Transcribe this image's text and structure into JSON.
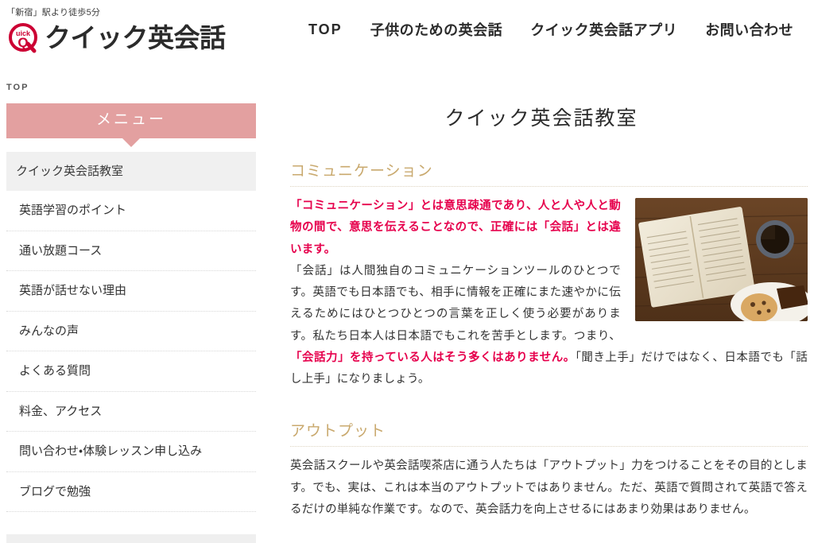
{
  "header": {
    "tagline": "「新宿」駅より徒歩5分",
    "brand_name": "クイック英会話",
    "logo_mark_text": "uick",
    "logo_letter": "Q",
    "brand_color": "#cc0033",
    "nav": [
      {
        "label": "TOP",
        "latin": true
      },
      {
        "label": "子供のための英会話",
        "latin": false
      },
      {
        "label": "クイック英会話アプリ",
        "latin": false
      },
      {
        "label": "お問い合わせ",
        "latin": false
      }
    ]
  },
  "sidebar": {
    "breadcrumb": "TOP",
    "menu_banner": "メニュー",
    "banner_color": "#e3a0a0",
    "items": [
      {
        "label": "クイック英会話教室",
        "active": true
      },
      {
        "label": "英語学習のポイント",
        "active": false
      },
      {
        "label": "通い放題コース",
        "active": false
      },
      {
        "label": "英語が話せない理由",
        "active": false
      },
      {
        "label": "みんなの声",
        "active": false
      },
      {
        "label": "よくある質問",
        "active": false
      },
      {
        "label": "料金、アクセス",
        "active": false
      },
      {
        "label": "問い合わせ・体験レッスン申し込み",
        "active": false
      },
      {
        "label": "ブログで勉強",
        "active": false
      }
    ]
  },
  "main": {
    "page_title": "クイック英会話教室",
    "heading_color": "#c9a96e",
    "accent_red": "#e6004c",
    "sections": [
      {
        "heading": "コミュニケーション",
        "lead": "「コミュニケーション」とは意思疎通であり、人と人や人と動物の間で、意思を伝えることなので、正確には「会話」とは違います。",
        "body_part1": "「会話」は人間独自のコミュニケーションツールのひとつです。英語でも日本語でも、相手に情報を正確にまた速やかに伝えるためにはひとつひとつの言葉を正しく使う必要があります。私たち日本人は日本語でもこれを苦手とします。つまり、",
        "body_highlight": "「会話力」を持っている人はそう多くはありません。",
        "body_part2": "「聞き上手」だけではなく、日本語でも「話し上手」になりましょう。",
        "figure_alt": "open-book-coffee-cookies-photo"
      },
      {
        "heading": "アウトプット",
        "body": "英会話スクールや英会話喫茶店に通う人たちは「アウトプット」力をつけることをその目的とします。でも、実は、これは本当のアウトプットではありません。ただ、英語で質問されて英語で答えるだけの単純な作業です。なので、英会話力を向上させるにはあまり効果はありません。"
      }
    ]
  }
}
